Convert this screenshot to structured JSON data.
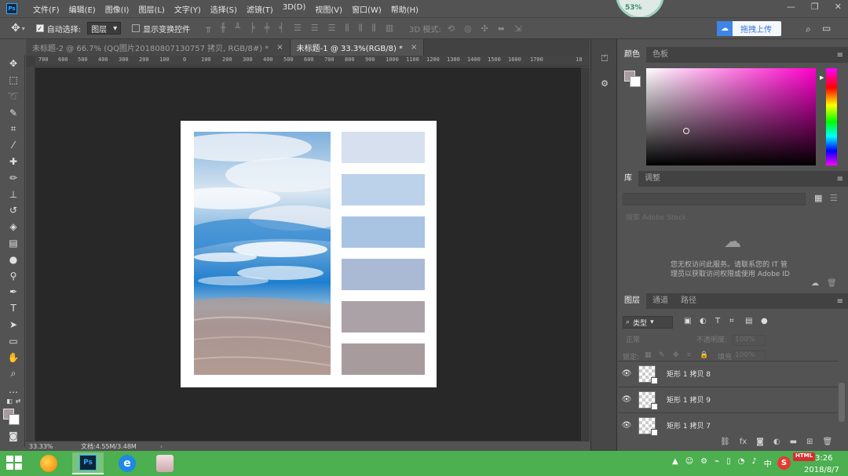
{
  "menu": {
    "app_icon": "Ps",
    "items": [
      "文件(F)",
      "编辑(E)",
      "图像(I)",
      "图层(L)",
      "文字(Y)",
      "选择(S)",
      "滤镜(T)",
      "3D(D)",
      "视图(V)",
      "窗口(W)",
      "帮助(H)"
    ],
    "perf_percent": "53%"
  },
  "options": {
    "auto_select_label": "自动选择:",
    "auto_select_target": "图层",
    "show_transform_label": "显示变换控件",
    "mode_3d_label": "3D 模式:",
    "upload_label": "拖拽上传"
  },
  "tabs": [
    {
      "label": "未标题-2 @ 66.7% (QQ图片20180807130757 拷贝, RGB/8#) *",
      "close": "×"
    },
    {
      "label": "未标题-1 @ 33.3%(RGB/8) *",
      "close": "×"
    }
  ],
  "ruler": {
    "top": [
      "700",
      "600",
      "500",
      "400",
      "300",
      "200",
      "100",
      "0",
      "100",
      "200",
      "300",
      "400",
      "500",
      "600",
      "700",
      "800",
      "900",
      "1000",
      "1100",
      "1200",
      "1300",
      "1400",
      "1500",
      "1600",
      "1700",
      "18"
    ]
  },
  "canvas": {
    "swatches": [
      "#d6e0ee",
      "#bcd1ea",
      "#a9c3e3",
      "#aab9d4",
      "#aba2a8",
      "#a89b9e"
    ]
  },
  "status": {
    "zoom": "33.33%",
    "doc": "文档:4.55M/3.48M",
    "arrow": "›"
  },
  "color_panel": {
    "tabs": [
      "颜色",
      "色板"
    ],
    "foreground": "#a99a9d",
    "background": "#ffffff"
  },
  "library_panel": {
    "tabs": [
      "库",
      "调整"
    ],
    "search_placeholder": "搜索 Adobe Stock",
    "message_line1": "您无权访问此服务。请联系您的 IT 管",
    "message_line2": "理员以获取访问权限或使用 Adobe ID"
  },
  "layers_panel": {
    "tabs": [
      "图层",
      "通道",
      "路径"
    ],
    "filter_kind": "类型",
    "blend_mode": "正常",
    "opacity_label": "不透明度:",
    "opacity_value": "100%",
    "lock_label": "锁定:",
    "fill_label": "填充:",
    "fill_value": "100%",
    "layers": [
      {
        "name": "矩形 1 拷贝 8"
      },
      {
        "name": "矩形 1 拷贝 9"
      },
      {
        "name": "矩形 1 拷贝 7"
      }
    ]
  },
  "taskbar": {
    "apps": [
      "folder-app",
      "photoshop-app",
      "ie-app",
      "photo-app"
    ],
    "ps_label": "Ps",
    "html_badge": "HTML",
    "time": "3:26",
    "date": "2018/8/7",
    "sogou": "S"
  }
}
